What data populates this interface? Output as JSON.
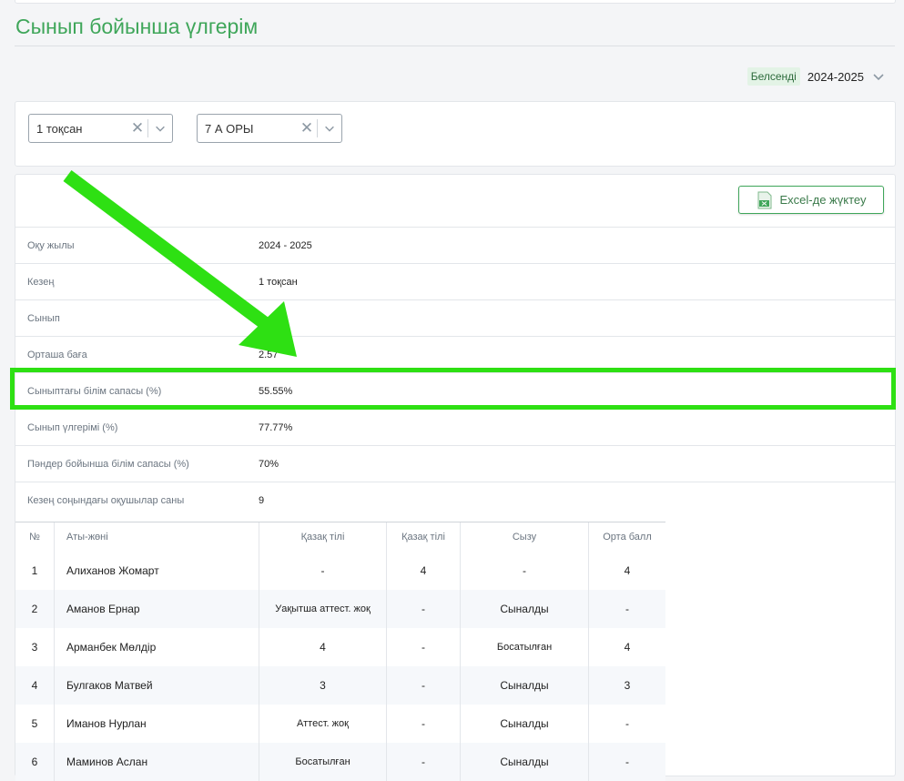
{
  "page": {
    "title": "Сынып бойынша үлгерім"
  },
  "year_selector": {
    "badge": "Белсенді",
    "value": "2024-2025"
  },
  "filters": {
    "period": {
      "value": "1 тоқсан",
      "clear": "✕"
    },
    "class": {
      "value": "7 А ОРЫ",
      "clear": "✕"
    }
  },
  "export": {
    "label": "Excel-де жүктеу"
  },
  "info": [
    {
      "label": "Оқу жылы",
      "value": "2024 - 2025"
    },
    {
      "label": "Кезең",
      "value": "1 тоқсан"
    },
    {
      "label": "Сынып",
      "value": ""
    },
    {
      "label": "Орташа баға",
      "value": "2.57"
    },
    {
      "label": "Сыныптағы білім сапасы (%)",
      "value": "55.55%"
    },
    {
      "label": "Сынып үлгерімі (%)",
      "value": "77.77%"
    },
    {
      "label": "Пәндер бойынша білім сапасы (%)",
      "value": "70%"
    },
    {
      "label": "Кезең соңындағы оқушылар саны",
      "value": "9"
    }
  ],
  "grades": {
    "headers": [
      "№",
      "Аты-жөні",
      "Қазақ тілі",
      "Қазақ тілі",
      "Сызу",
      "Орта балл"
    ],
    "rows": [
      [
        "1",
        "Алиханов Жомарт",
        "-",
        "4",
        "-",
        "4"
      ],
      [
        "2",
        "Аманов Ернар",
        "Уақытша аттест. жоқ",
        "-",
        "Сыналды",
        "-"
      ],
      [
        "3",
        "Арманбек Мөлдір",
        "4",
        "-",
        "Босатылған",
        "4"
      ],
      [
        "4",
        "Булгаков Матвей",
        "3",
        "-",
        "Сыналды",
        "3"
      ],
      [
        "5",
        "Иманов Нурлан",
        "Аттест. жоқ",
        "-",
        "Сыналды",
        "-"
      ],
      [
        "6",
        "Маминов Аслан",
        "Босатылған",
        "-",
        "Сыналды",
        "-"
      ]
    ]
  },
  "colors": {
    "accent": "#3fa65a",
    "annotation": "#2ee013"
  },
  "annotation": {
    "arrow": "arrow-icon",
    "highlight": "highlight-box"
  }
}
